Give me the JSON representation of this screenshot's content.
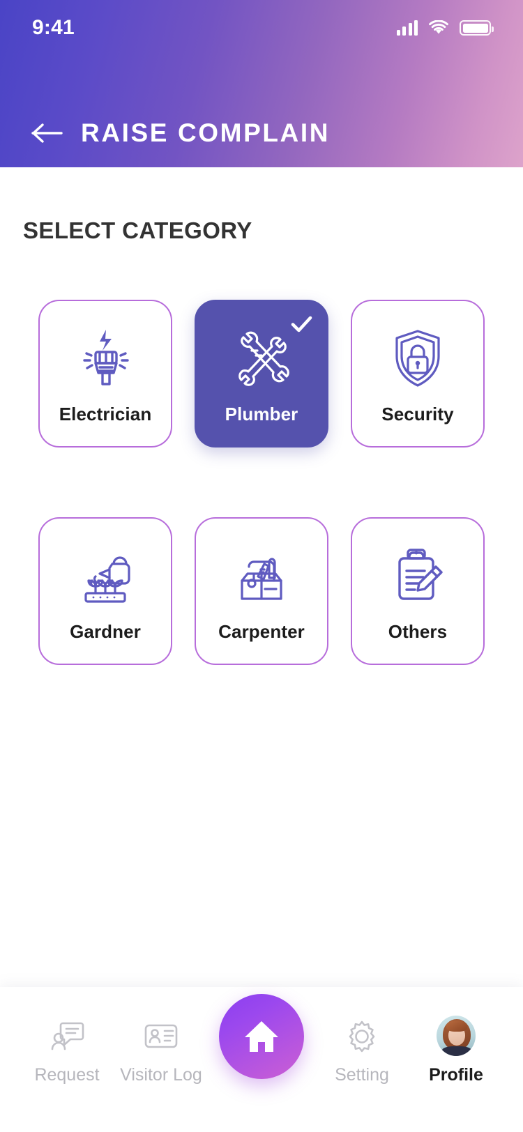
{
  "status_bar": {
    "time": "9:41",
    "signal_icon": "cellular-signal-icon",
    "wifi_icon": "wifi-icon",
    "battery_icon": "battery-icon"
  },
  "header": {
    "back_icon": "back-arrow-icon",
    "title": "RAISE COMPLAIN",
    "gradient_from": "#4a44c6",
    "gradient_to": "#dda3cb"
  },
  "main": {
    "section_title": "SELECT CATEGORY",
    "selected_category": "Plumber",
    "accent_color": "#5552ad",
    "border_color": "#b76ddb",
    "categories": [
      {
        "label": "Electrician",
        "icon": "electric-plug-icon",
        "selected": false
      },
      {
        "label": "Plumber",
        "icon": "crossed-wrenches-icon",
        "selected": true
      },
      {
        "label": "Security",
        "icon": "shield-lock-icon",
        "selected": false
      },
      {
        "label": "Gardner",
        "icon": "watering-can-plants-icon",
        "selected": false
      },
      {
        "label": "Carpenter",
        "icon": "toolbox-icon",
        "selected": false
      },
      {
        "label": "Others",
        "icon": "clipboard-pencil-icon",
        "selected": false
      }
    ]
  },
  "bottom_nav": {
    "active_item": "Profile",
    "home_icon": "home-icon",
    "items": [
      {
        "label": "Request",
        "icon": "person-message-icon",
        "active": false
      },
      {
        "label": "Visitor Log",
        "icon": "id-card-icon",
        "active": false
      },
      {
        "label": "Setting",
        "icon": "gear-icon",
        "active": false
      },
      {
        "label": "Profile",
        "icon": "avatar-photo",
        "active": true
      }
    ]
  }
}
